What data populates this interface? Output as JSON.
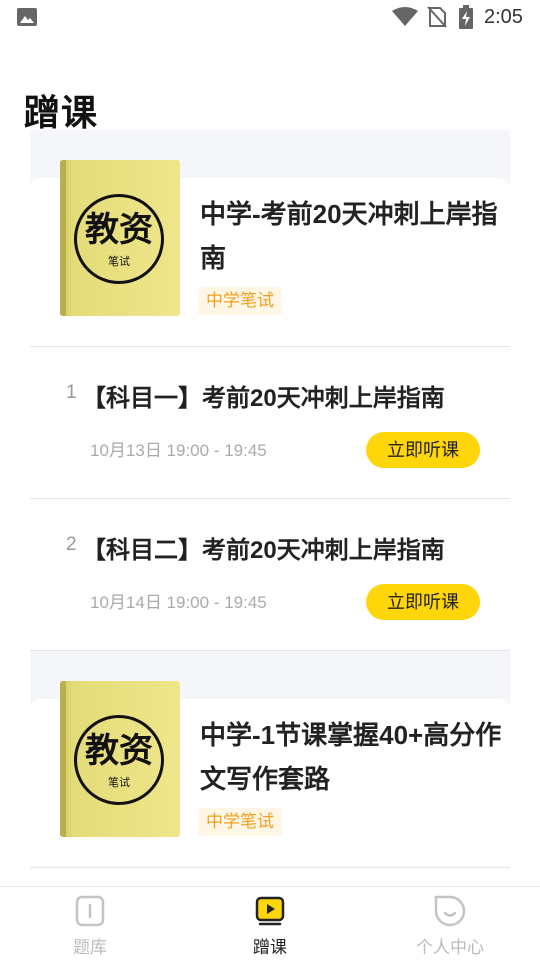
{
  "status_bar": {
    "time": "2:05"
  },
  "page_title": "蹭课",
  "courses": [
    {
      "cover_main": "教资",
      "cover_sub": "笔试",
      "title": "中学-考前20天冲刺上岸指南",
      "tag": "中学笔试",
      "lessons": [
        {
          "num": "1",
          "title": "【科目一】考前20天冲刺上岸指南",
          "time": "10月13日 19:00 - 19:45",
          "button": "立即听课"
        },
        {
          "num": "2",
          "title": "【科目二】考前20天冲刺上岸指南",
          "time": "10月14日 19:00 - 19:45",
          "button": "立即听课"
        }
      ]
    },
    {
      "cover_main": "教资",
      "cover_sub": "笔试",
      "title": "中学-1节课掌握40+高分作文写作套路",
      "tag": "中学笔试"
    }
  ],
  "bottom_nav": [
    {
      "label": "题库",
      "icon": "question-bank-icon",
      "active": false
    },
    {
      "label": "蹭课",
      "icon": "video-play-icon",
      "active": true
    },
    {
      "label": "个人中心",
      "icon": "profile-face-icon",
      "active": false
    }
  ],
  "colors": {
    "accent": "#ffd60a",
    "tag_text": "#f0a020",
    "tag_bg": "#fff7e6"
  }
}
